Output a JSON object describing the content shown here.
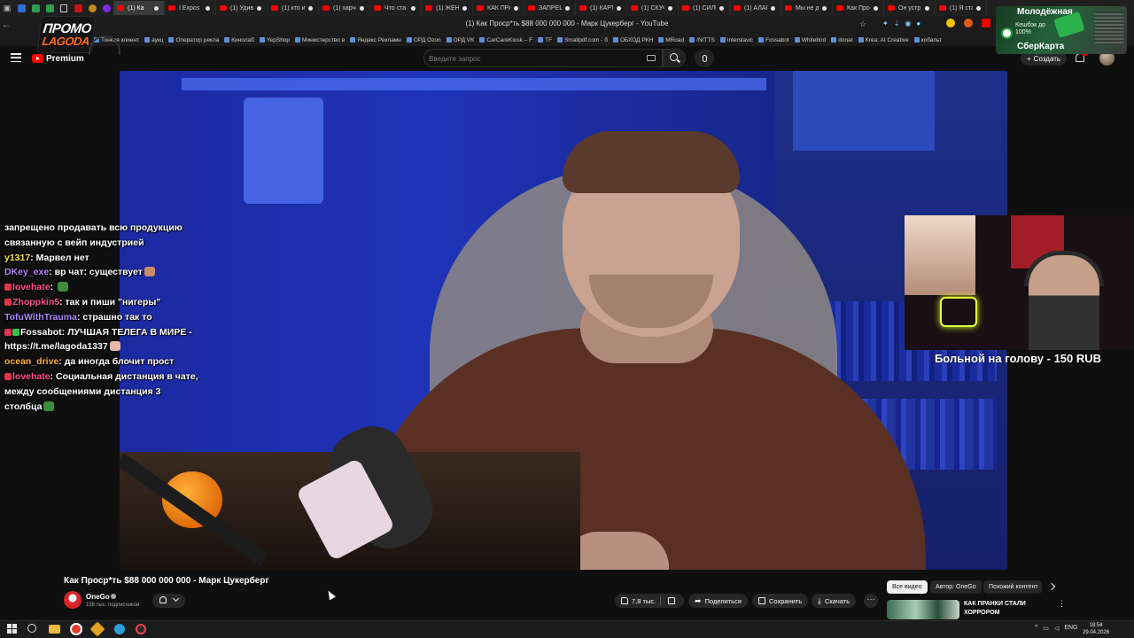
{
  "browser": {
    "window_title": "(1) Как Проср*ть $88 000 000 000 - Марк Цукерберг - YouTube",
    "tabs": [
      {
        "label": "(1) Ка",
        "active": true
      },
      {
        "label": "I Expos"
      },
      {
        "label": "(1) Удиви"
      },
      {
        "label": "(1) кто и з"
      },
      {
        "label": "(1) харчев"
      },
      {
        "label": "Что ста"
      },
      {
        "label": "(1) ЖЕНСК"
      },
      {
        "label": "КАК ПРАН"
      },
      {
        "label": "ЗАПРЕЩЕ"
      },
      {
        "label": "(1) КАРТА"
      },
      {
        "label": "(1) СКУФ"
      },
      {
        "label": "(1) СИЛЬН"
      },
      {
        "label": "(1) АЛАБУ"
      },
      {
        "label": "Мы не д"
      },
      {
        "label": "Как Про"
      },
      {
        "label": "Он устр"
      },
      {
        "label": "(1) Я стал"
      }
    ],
    "bookmarks": [
      "Тонкая клиент",
      "аукц",
      "Оператор рекла",
      "Кинолаб",
      "YepShop",
      "Министерство в",
      "Яндекс Рекламн",
      "ОРД Ozon",
      "ОРД VK",
      "CarCareKiosk – F",
      "TF",
      "Smallpdf.com - б",
      "ОБХОД РКН",
      "MRoad",
      "/N/TTS",
      "Interslavic",
      "Fossabot",
      "Whitebird",
      "donat",
      "Krea: AI Creative",
      "кобальт"
    ]
  },
  "overlay": {
    "promo_line1": "ПРОМО",
    "promo_line2": "LAGODA",
    "sber_line1": "Молодёжная",
    "sber_line2": "Кешбэк до 100%",
    "sber_line3": "СберКарта",
    "donation": "Больной на голову - 150 RUB"
  },
  "chat": [
    {
      "user": "",
      "text": "запрещено продавать всю продукцию связанную с вейп индустрией",
      "color": ""
    },
    {
      "user": "y1317",
      "text": "Марвел нет",
      "color": "u-yellow"
    },
    {
      "user": "DKey_exe",
      "text": "вр чат: существует",
      "color": "u-purple",
      "emote": "#c98b6a"
    },
    {
      "user": "lovehate",
      "text": "",
      "color": "u-pink",
      "mark": "red",
      "emote": "#3c8c3c"
    },
    {
      "user": "Zhoppkin5",
      "text": "так и пиши \"нигеры\"",
      "color": "u-pink",
      "mark": "red"
    },
    {
      "user": "TofuWithTrauma",
      "text": "страшно так то",
      "color": "u-violet"
    },
    {
      "user": "Fossabot",
      "text": "ЛУЧШАЯ ТЕЛЕГА В МИРЕ - https://t.me/lagoda1337",
      "color": "",
      "mark": "redgreen",
      "emote": "#e8b9a6"
    },
    {
      "user": "ocean_drive",
      "text": "да иногда блочит прост",
      "color": "u-orange"
    },
    {
      "user": "lovehate",
      "text": "Социальная дистанция в чате, между сообщениями дистанция 3 столбца",
      "color": "u-pink",
      "mark": "red",
      "emote": "#3c8c3c"
    }
  ],
  "youtube": {
    "premium_label": "Premium",
    "search_placeholder": "Введите запрос",
    "create_label": "Создать",
    "notifications_count": "9+",
    "video_title": "Как Проср*ть $88 000 000 000 - Марк Цукерберг",
    "channel_name": "OneGo",
    "subscribers": "156 тыс. подписчиков",
    "likes": "7,8 тыс.",
    "share_label": "Поделиться",
    "save_label": "Сохранить",
    "download_label": "Скачать",
    "chips": [
      "Все видео",
      "Автор: OneGo",
      "Похожий контент"
    ],
    "related_title": "КАК ПРАНКИ СТАЛИ ХОРРОРОМ"
  },
  "taskbar": {
    "language": "ENG",
    "time": "18:54",
    "date": "29.04.2026"
  }
}
